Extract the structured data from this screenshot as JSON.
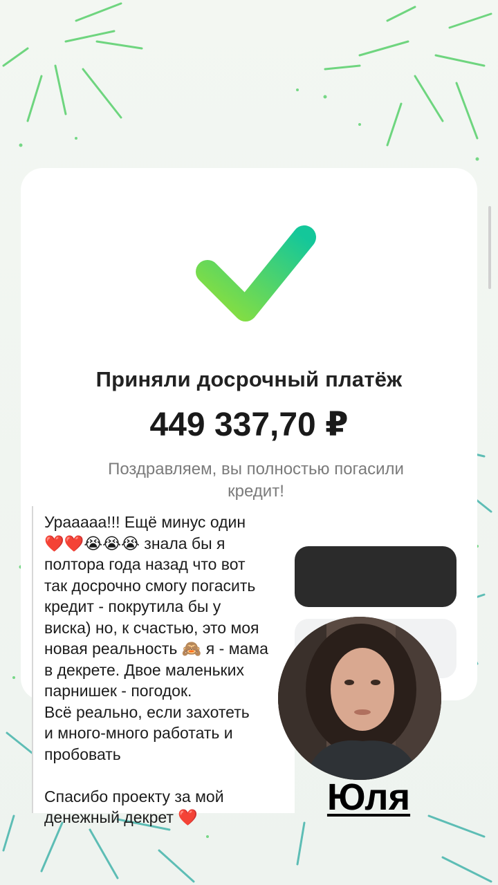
{
  "colors": {
    "check_gradient_start": "#14c79a",
    "check_gradient_end": "#8fe03a",
    "spark_green": "#4ccf6a",
    "spark_teal": "#3ab0a7"
  },
  "card": {
    "title": "Приняли досрочный платёж",
    "amount": "449 337,70 ₽",
    "subtitle": "Поздравляем, вы полностью погасили кредит!"
  },
  "testimonial": {
    "text": "Урааааа!!! Ещё минус один\n❤️❤️😭😭😭 знала бы я\nполтора года назад что вот\nтак досрочно смогу погасить\nкредит - покрутила бы у\nвиска) но, к счастью, это моя\nновая реальность 🙈 я - мама\nв декрете. Двое маленьких\nпарнишек - погодок.\nВсё реально, если захотеть\nи много-много работать и\nпробовать\n\nСпасибо проекту за мой\nденежный декрет ❤️"
  },
  "author": {
    "name": "Юля"
  }
}
